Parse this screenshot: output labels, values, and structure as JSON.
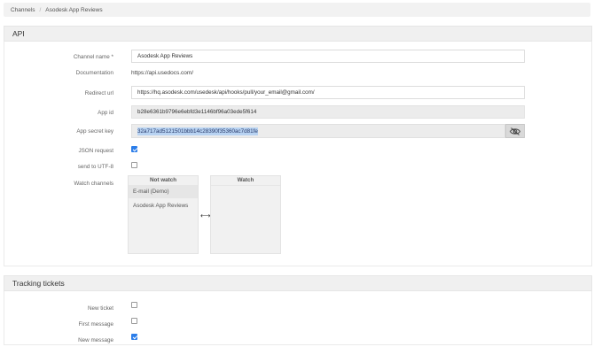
{
  "breadcrumb": {
    "root": "Channels",
    "separator": "/",
    "current": "Asodesk App Reviews"
  },
  "api_section": {
    "title": "API"
  },
  "fields": {
    "channel_name": {
      "label": "Channel name",
      "required_mark": "*",
      "value": "Asodesk App Reviews"
    },
    "documentation": {
      "label": "Documentation",
      "value": "https://api.usedocs.com/"
    },
    "redirect_url": {
      "label": "Redirect url",
      "value": "https://hq.asodesk.com/usedesk/api/hooks/pull/your_email@gmail.com/"
    },
    "app_id": {
      "label": "App id",
      "value": "b28e6361b9796e6ebfd3e1146bf96a03ede5f614"
    },
    "app_secret_key": {
      "label": "App secret key",
      "value": "32a717ad5121501bbb14c28390f35360ac7d81fe",
      "icon": "eye-slash-icon"
    },
    "json_request": {
      "label": "JSON request",
      "checked": true
    },
    "send_to_utf8": {
      "label": "send to UTF-8",
      "checked": false
    },
    "watch_channels": {
      "label": "Watch channels",
      "not_watch_title": "Not watch",
      "watch_title": "Watch",
      "not_watch_items": [
        "E-mail (Demo)",
        "Asodesk App Reviews"
      ],
      "watch_items": [],
      "transfer_icon": "left-right-arrow-icon"
    }
  },
  "tracking_section": {
    "title": "Tracking tickets",
    "new_ticket": {
      "label": "New ticket",
      "checked": false
    },
    "first_message": {
      "label": "First message",
      "checked": false
    },
    "new_message": {
      "label": "New message",
      "checked": true
    }
  },
  "colors": {
    "accent": "#2b7de9",
    "panel": "#f0f0f0",
    "selection": "#b8d3f2"
  }
}
